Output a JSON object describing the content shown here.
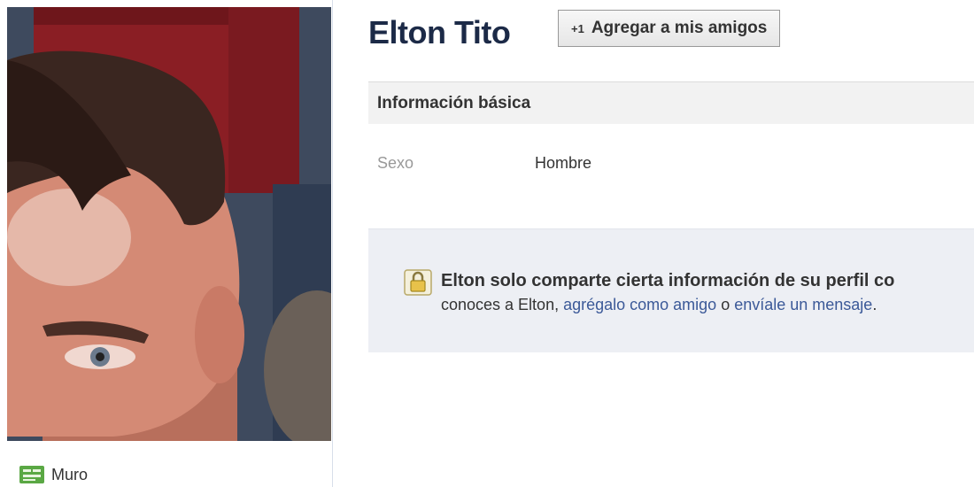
{
  "profile": {
    "name": "Elton Tito",
    "add_friend_prefix": "+1",
    "add_friend_label": "Agregar a mis amigos"
  },
  "sidebar": {
    "items": [
      {
        "label": "Muro",
        "icon": "wall-icon"
      }
    ]
  },
  "basic_info": {
    "title": "Información básica",
    "rows": [
      {
        "key": "Sexo",
        "value": "Hombre"
      }
    ]
  },
  "privacy": {
    "icon": "lock-icon",
    "line1": "Elton solo comparte cierta información de su perfil co",
    "line2_prefix": "conoces a Elton, ",
    "link_add_friend": "agrégalo como amigo",
    "line2_mid": " o ",
    "link_message": "envíale un mensaje",
    "line2_suffix": "."
  },
  "colors": {
    "name": "#1c2a47",
    "link": "#3b5998",
    "notice_bg": "#edeff4"
  }
}
